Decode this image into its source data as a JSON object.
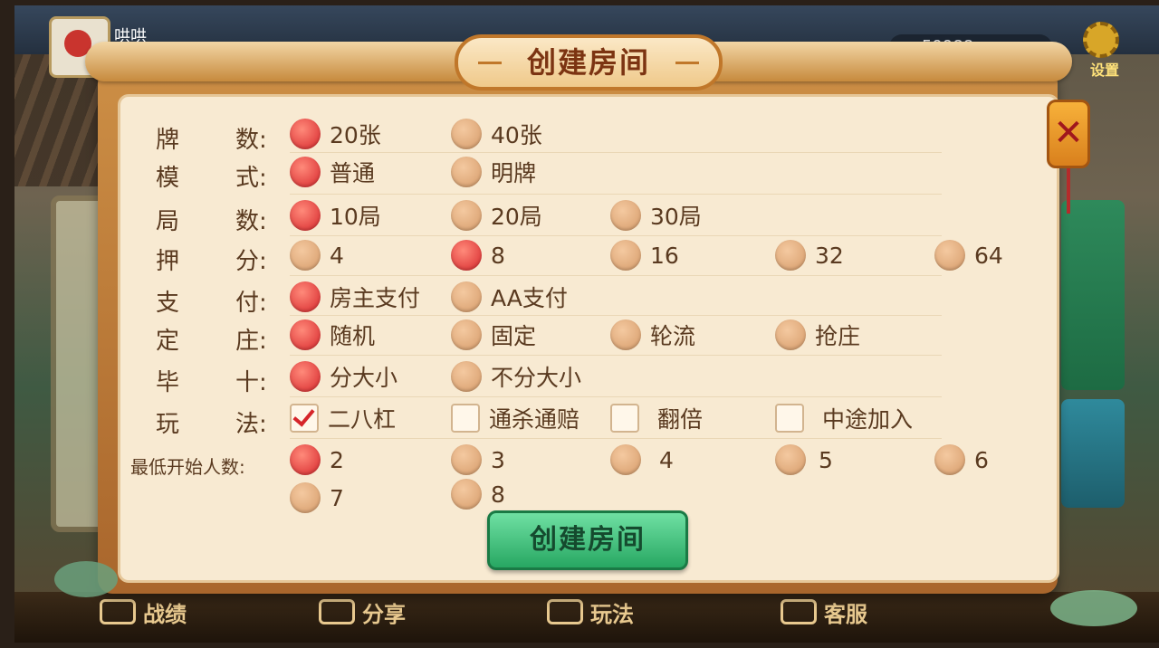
{
  "header": {
    "username": "哄哄",
    "coins": "59988",
    "settings_label": "设置"
  },
  "dialog": {
    "title": "创建房间",
    "close_symbol": "✕",
    "create_button": "创建房间"
  },
  "rows": {
    "cards": {
      "label1": "牌",
      "label2": "数:",
      "options": [
        {
          "text": "20张",
          "selected": true
        },
        {
          "text": "40张",
          "selected": false
        }
      ]
    },
    "mode": {
      "label1": "模",
      "label2": "式:",
      "options": [
        {
          "text": "普通",
          "selected": true
        },
        {
          "text": "明牌",
          "selected": false
        }
      ]
    },
    "rounds": {
      "label1": "局",
      "label2": "数:",
      "options": [
        {
          "text": "10局",
          "selected": true
        },
        {
          "text": "20局",
          "selected": false
        },
        {
          "text": "30局",
          "selected": false
        }
      ]
    },
    "bet": {
      "label1": "押",
      "label2": "分:",
      "options": [
        {
          "text": "4",
          "selected": false
        },
        {
          "text": "8",
          "selected": true
        },
        {
          "text": "16",
          "selected": false
        },
        {
          "text": "32",
          "selected": false
        },
        {
          "text": "64",
          "selected": false
        }
      ]
    },
    "payment": {
      "label1": "支",
      "label2": "付:",
      "options": [
        {
          "text": "房主支付",
          "selected": true
        },
        {
          "text": "AA支付",
          "selected": false
        }
      ]
    },
    "banker": {
      "label1": "定",
      "label2": "庄:",
      "options": [
        {
          "text": "随机",
          "selected": true
        },
        {
          "text": "固定",
          "selected": false
        },
        {
          "text": "轮流",
          "selected": false
        },
        {
          "text": "抢庄",
          "selected": false
        }
      ]
    },
    "bishi": {
      "label1": "毕",
      "label2": "十:",
      "options": [
        {
          "text": "分大小",
          "selected": true
        },
        {
          "text": "不分大小",
          "selected": false
        }
      ]
    },
    "play": {
      "label1": "玩",
      "label2": "法:",
      "options": [
        {
          "text": "二八杠",
          "checked": true
        },
        {
          "text": "通杀通赔",
          "checked": false
        },
        {
          "text": "翻倍",
          "checked": false
        },
        {
          "text": "中途加入",
          "checked": false
        }
      ]
    },
    "min_players": {
      "label": "最低开始人数:",
      "options": [
        {
          "text": "2",
          "selected": true
        },
        {
          "text": "3",
          "selected": false
        },
        {
          "text": "4",
          "selected": false
        },
        {
          "text": "5",
          "selected": false
        },
        {
          "text": "6",
          "selected": false
        },
        {
          "text": "7",
          "selected": false
        },
        {
          "text": "8",
          "selected": false
        }
      ]
    }
  },
  "bottom_nav": [
    {
      "label": "战绩",
      "icon": "record-icon"
    },
    {
      "label": "分享",
      "icon": "share-icon"
    },
    {
      "label": "玩法",
      "icon": "rules-icon"
    },
    {
      "label": "客服",
      "icon": "support-icon"
    }
  ]
}
